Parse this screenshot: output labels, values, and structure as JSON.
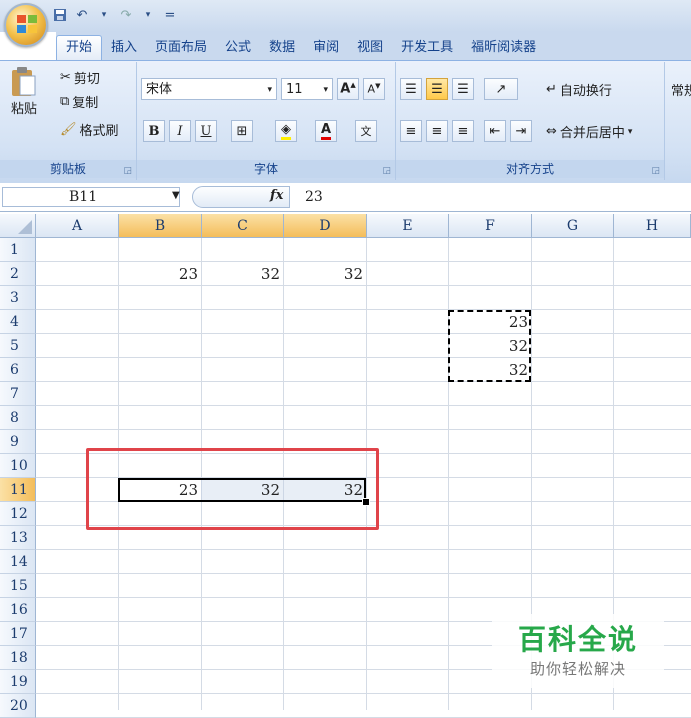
{
  "quick_access": {
    "dropdown": "="
  },
  "tabs": [
    "开始",
    "插入",
    "页面布局",
    "公式",
    "数据",
    "审阅",
    "视图",
    "开发工具",
    "福昕阅读器"
  ],
  "clipboard": {
    "paste": "粘贴",
    "cut": "剪切",
    "copy": "复制",
    "format_painter": "格式刷",
    "label": "剪贴板"
  },
  "font": {
    "name": "宋体",
    "size": "11",
    "bold": "B",
    "italic": "I",
    "underline": "U",
    "font_color": "A",
    "phonetic": "文",
    "label": "字体"
  },
  "alignment": {
    "wrap": "自动换行",
    "merge": "合并后居中",
    "label": "对齐方式"
  },
  "number": {
    "format": "常规"
  },
  "formula_bar": {
    "name_box": "B11",
    "fx": "fx",
    "value": "23"
  },
  "columns": [
    "A",
    "B",
    "C",
    "D",
    "E",
    "F",
    "G",
    "H"
  ],
  "rows": [
    "1",
    "2",
    "3",
    "4",
    "5",
    "6",
    "7",
    "8",
    "9",
    "10",
    "11",
    "12",
    "13",
    "14",
    "15",
    "16",
    "17",
    "18",
    "19",
    "20"
  ],
  "cells": {
    "B2": "23",
    "C2": "32",
    "D2": "32",
    "F4": "23",
    "F5": "32",
    "F6": "32",
    "B11": "23",
    "C11": "32",
    "D11": "32"
  },
  "watermark": {
    "title": "百科全说",
    "subtitle": "助你轻松解决"
  },
  "colors": {
    "annotation": "#e0444a",
    "selected_header": "#f4bd5a",
    "ribbon": "#d4e2f4"
  }
}
